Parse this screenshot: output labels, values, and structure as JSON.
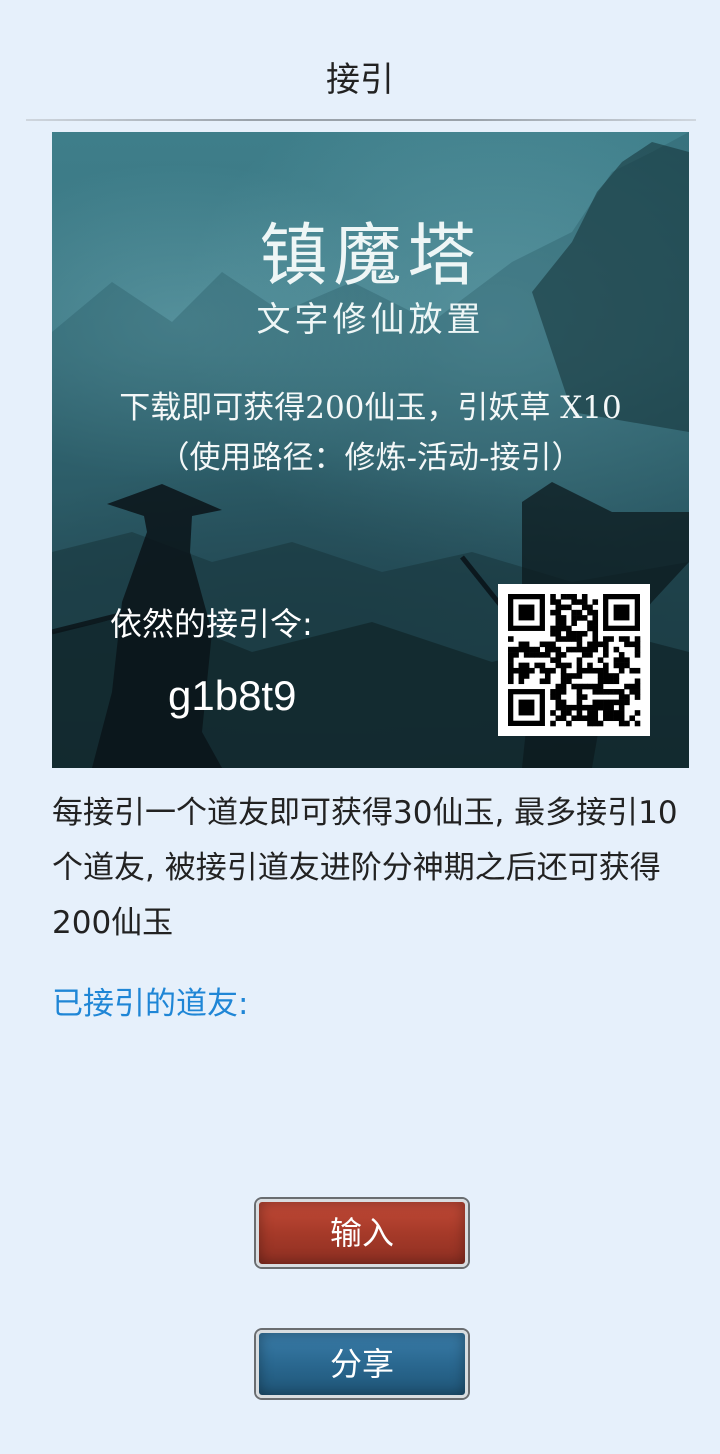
{
  "header": {
    "title": "接引"
  },
  "banner": {
    "game_title": "镇魔塔",
    "game_subtitle": "文字修仙放置",
    "promo_line1": "下载即可获得200仙玉，引妖草 X10",
    "promo_line2": "（使用路径：修炼-活动-接引）",
    "code_label": "依然的接引令:",
    "code_value": "g1b8t9",
    "qr_icon": "qr-code-icon"
  },
  "main": {
    "description": "每接引一个道友即可获得30仙玉, 最多接引10个道友, 被接引道友进阶分神期之后还可获得200仙玉",
    "invited_label": "已接引的道友:"
  },
  "buttons": {
    "input_label": "输入",
    "share_label": "分享"
  },
  "colors": {
    "background": "#e6f0fb",
    "link_blue": "#1f86d6",
    "input_button": "#a63a29",
    "share_button": "#2a6890"
  }
}
